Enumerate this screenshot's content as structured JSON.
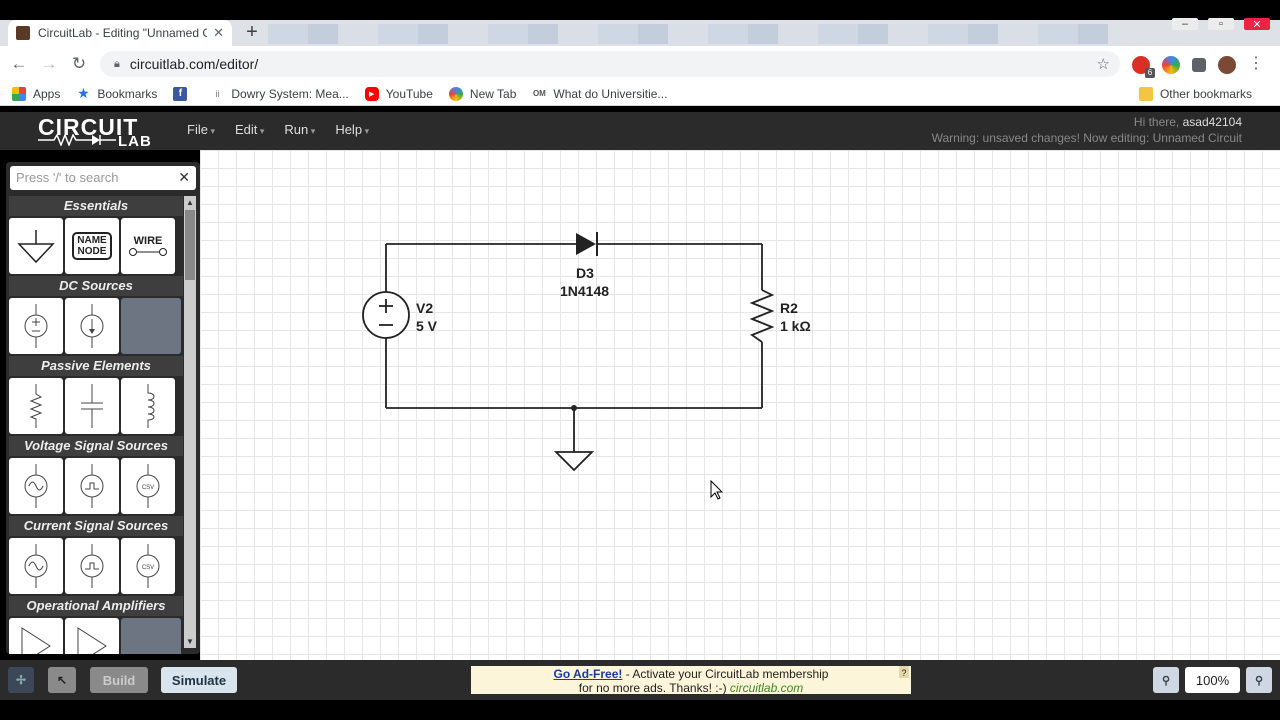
{
  "browser": {
    "tab_title": "CircuitLab - Editing \"Unnamed C",
    "url": "circuitlab.com/editor/",
    "bookmarks": [
      {
        "label": "Apps"
      },
      {
        "label": "Bookmarks"
      },
      {
        "label": ""
      },
      {
        "label": "Dowry System: Mea..."
      },
      {
        "label": "YouTube"
      },
      {
        "label": "New Tab"
      },
      {
        "label": "What do Universitie..."
      }
    ],
    "other_bookmarks": "Other bookmarks",
    "ext_badge": "6"
  },
  "app": {
    "logo_top": "CIRCUIT",
    "logo_bottom": "LAB",
    "menu": [
      "File",
      "Edit",
      "Run",
      "Help"
    ],
    "greeting_prefix": "Hi there,",
    "username": "asad42104",
    "warning": "Warning: unsaved changes! Now editing: Unnamed Circuit"
  },
  "sidebar": {
    "search_placeholder": "Press '/' to search",
    "categories": [
      "Essentials",
      "DC Sources",
      "Passive Elements",
      "Voltage Signal Sources",
      "Current Signal Sources",
      "Operational Amplifiers"
    ],
    "name_node_label": [
      "NAME",
      "NODE"
    ],
    "wire_label": "WIRE"
  },
  "circuit": {
    "diode_name": "D3",
    "diode_model": "1N4148",
    "source_name": "V2",
    "source_value": "5 V",
    "resistor_name": "R2",
    "resistor_value": "1 kΩ"
  },
  "statusbar": {
    "build": "Build",
    "simulate": "Simulate",
    "ad_link": "Go Ad-Free!",
    "ad_text1": " - Activate your CircuitLab membership",
    "ad_text2": "for no more ads. Thanks! :-) ",
    "ad_url": "circuitlab.com",
    "ad_q": "?",
    "zoom": "100%"
  }
}
